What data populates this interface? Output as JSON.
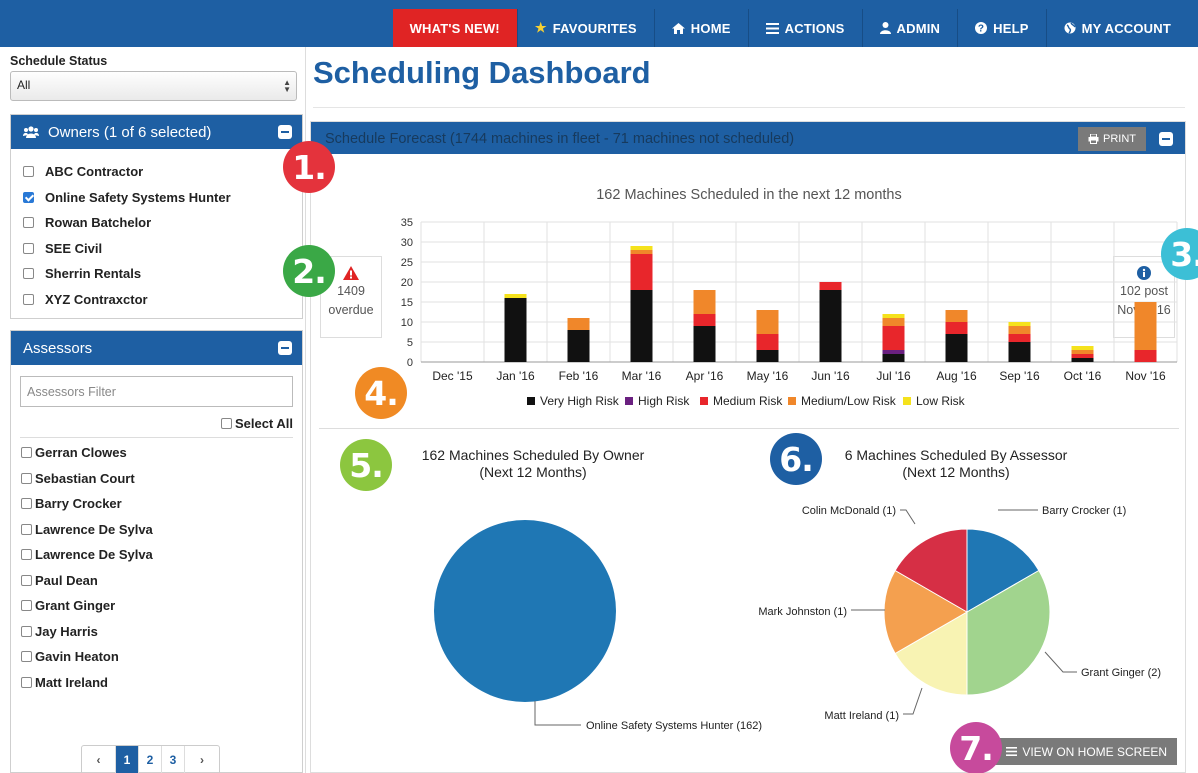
{
  "nav": {
    "whats_new": "WHAT'S NEW!",
    "favourites": "FAVOURITES",
    "home": "HOME",
    "actions": "ACTIONS",
    "admin": "ADMIN",
    "help": "HELP",
    "my_account": "MY ACCOUNT"
  },
  "sidebar": {
    "status_label": "Schedule Status",
    "status_value": "All",
    "owners_title": "Owners (1 of 6 selected)",
    "owners": [
      {
        "label": "ABC Contractor",
        "checked": false
      },
      {
        "label": "Online Safety Systems Hunter",
        "checked": true
      },
      {
        "label": "Rowan Batchelor",
        "checked": false
      },
      {
        "label": "SEE Civil",
        "checked": false
      },
      {
        "label": "Sherrin Rentals",
        "checked": false
      },
      {
        "label": "XYZ Contraxctor",
        "checked": false
      }
    ],
    "assessors_title": "Assessors",
    "assessors_filter_placeholder": "Assessors Filter",
    "select_all": "Select All",
    "assessors": [
      "Gerran Clowes",
      "Sebastian Court",
      "Barry Crocker",
      "Lawrence De Sylva",
      "Lawrence De Sylva",
      "Paul Dean",
      "Grant Ginger",
      "Jay Harris",
      "Gavin Heaton",
      "Matt Ireland"
    ],
    "pager": {
      "prev": "‹",
      "pages": [
        "1",
        "2",
        "3"
      ],
      "active": "1",
      "next": "›"
    }
  },
  "main": {
    "title": "Scheduling Dashboard",
    "forecast_header": "Schedule Forecast (1744 machines in fleet - 71 machines not scheduled)",
    "print_label": "PRINT",
    "overdue": {
      "count": "1409",
      "label": "overdue"
    },
    "post": {
      "line1": "102 post",
      "line2": "Nov 2016"
    },
    "owner_pie_title": [
      "162 Machines Scheduled By Owner",
      "(Next 12 Months)"
    ],
    "assessor_pie_title": [
      "6 Machines Scheduled By Assessor",
      "(Next 12 Months)"
    ],
    "view_home": "VIEW ON HOME SCREEN"
  },
  "badges": [
    "1.",
    "2.",
    "3.",
    "4.",
    "5.",
    "6.",
    "7."
  ],
  "colors": {
    "brand": "#1e5fa3",
    "alert": "#e02424"
  },
  "chart_data": [
    {
      "type": "bar",
      "stacked": true,
      "title": "162 Machines Scheduled in the next 12 months",
      "categories": [
        "Dec '15",
        "Jan '16",
        "Feb '16",
        "Mar '16",
        "Apr '16",
        "May '16",
        "Jun '16",
        "Jul '16",
        "Aug '16",
        "Sep '16",
        "Oct '16",
        "Nov '16"
      ],
      "ylim": [
        0,
        35
      ],
      "yticks": [
        0,
        5,
        10,
        15,
        20,
        25,
        30,
        35
      ],
      "grid": true,
      "legend": "bottom",
      "series": [
        {
          "name": "Very High Risk",
          "color": "#111111",
          "values": [
            0,
            16,
            8,
            18,
            9,
            3,
            18,
            2,
            7,
            5,
            1,
            0
          ]
        },
        {
          "name": "High Risk",
          "color": "#6a2080",
          "values": [
            0,
            0,
            0,
            0,
            0,
            0,
            0,
            1,
            0,
            0,
            0,
            0
          ]
        },
        {
          "name": "Medium Risk",
          "color": "#e8262b",
          "values": [
            0,
            0,
            0,
            9,
            3,
            4,
            2,
            6,
            3,
            2,
            1,
            3
          ]
        },
        {
          "name": "Medium/Low Risk",
          "color": "#f0872a",
          "values": [
            0,
            0,
            3,
            1,
            6,
            6,
            0,
            2,
            3,
            2,
            1,
            12
          ]
        },
        {
          "name": "Low Risk",
          "color": "#f5e21c",
          "values": [
            0,
            1,
            0,
            1,
            0,
            0,
            0,
            1,
            0,
            1,
            1,
            0
          ]
        }
      ]
    },
    {
      "type": "pie",
      "title": "162 Machines Scheduled By Owner",
      "slices": [
        {
          "label": "Online Safety Systems Hunter (162)",
          "value": 162,
          "color": "#1f77b4"
        }
      ]
    },
    {
      "type": "pie",
      "title": "6 Machines Scheduled By Assessor",
      "slices": [
        {
          "label": "Barry Crocker (1)",
          "value": 1,
          "color": "#1f77b4"
        },
        {
          "label": "Grant Ginger (2)",
          "value": 2,
          "color": "#a1d48e"
        },
        {
          "label": "Matt Ireland (1)",
          "value": 1,
          "color": "#f8f3b3"
        },
        {
          "label": "Mark Johnston (1)",
          "value": 1,
          "color": "#f4a04f"
        },
        {
          "label": "Colin McDonald (1)",
          "value": 1,
          "color": "#d62f45"
        }
      ]
    }
  ]
}
